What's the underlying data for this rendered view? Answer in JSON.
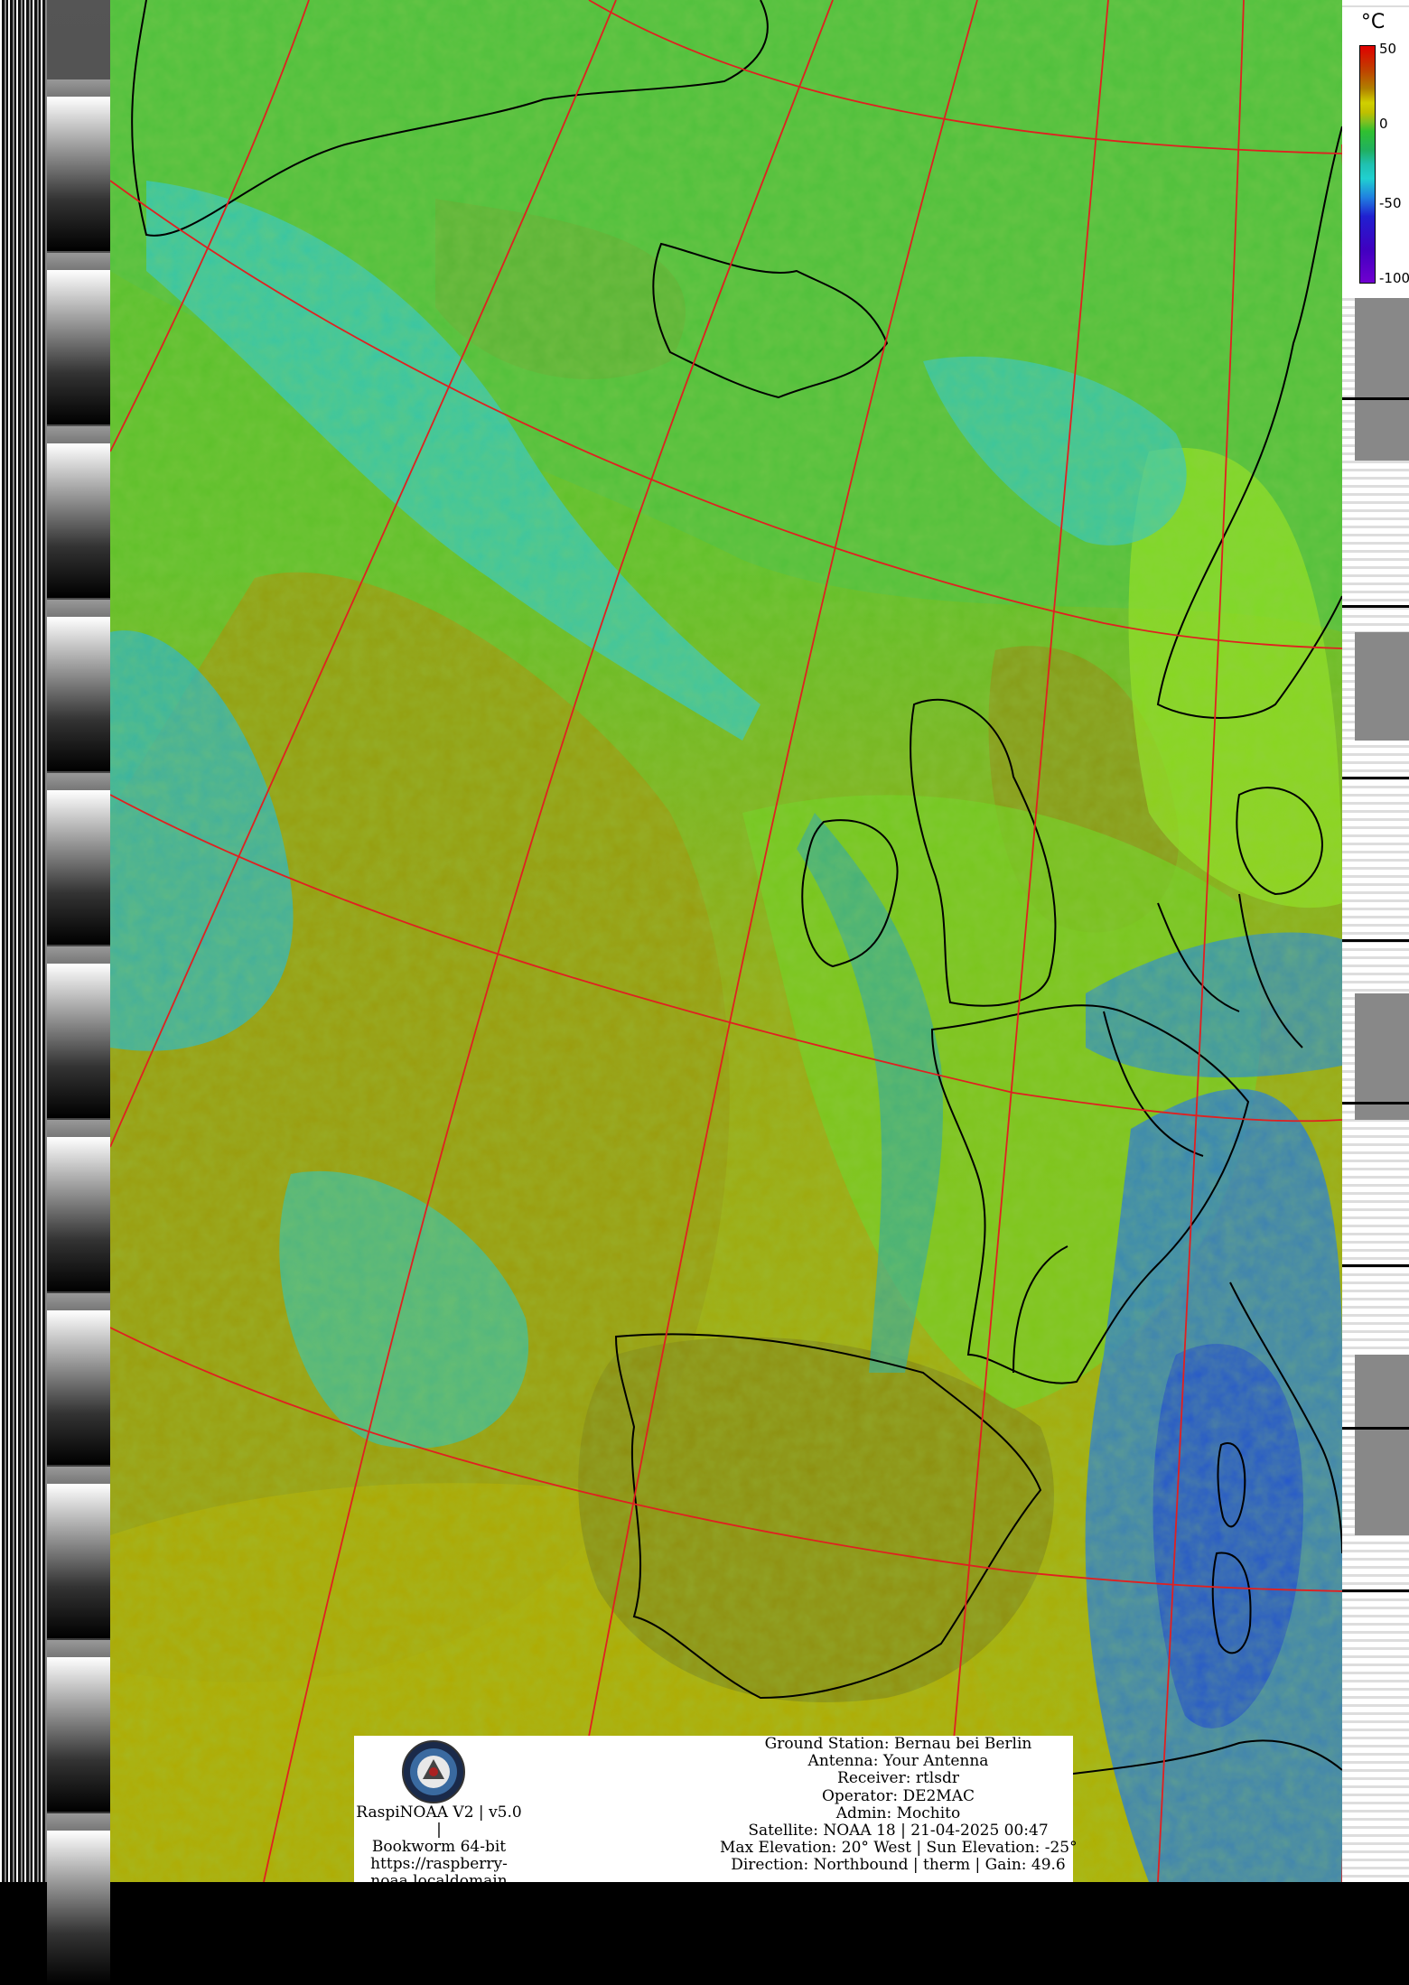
{
  "colorbar": {
    "unit": "°C",
    "ticks": [
      "50",
      "0",
      "-50",
      "-100"
    ]
  },
  "info": {
    "software": [
      "RaspiNOAA V2 | v5.0 |",
      "Bookworm 64-bit",
      "https://raspberry-",
      "noaa.localdomain"
    ],
    "station": [
      "Ground Station: Bernau bei Berlin",
      "Antenna: Your Antenna",
      "Receiver: rtlsdr",
      "Operator: DE2MAC",
      "Admin: Mochito",
      "Satellite: NOAA 18 | 21-04-2025 00:47",
      "Max Elevation: 20° West | Sun Elevation: -25°",
      "Direction: Northbound | therm | Gain: 49.6"
    ]
  },
  "map_layers": {
    "colors": {
      "warm_olive": "#a8a800",
      "dark_olive": "#8a8a10",
      "green": "#60c020",
      "bright_green": "#90e020",
      "teal": "#20b090",
      "cyan": "#30d0d0",
      "blue": "#2060d0",
      "graticule": "#e02020",
      "coastline": "#000000"
    }
  }
}
